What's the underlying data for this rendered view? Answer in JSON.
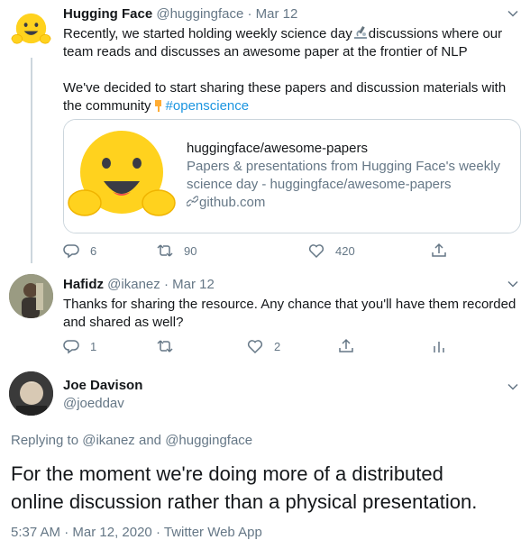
{
  "tweet1": {
    "name": "Hugging Face",
    "handle": "@huggingface",
    "separator": "·",
    "date": "Mar 12",
    "line1": "Recently, we started holding weekly science day",
    "line1b": "discussions where our",
    "line2": "team reads and discusses an awesome paper at the frontier of NLP",
    "line3": "We've decided to start sharing these papers and discussion materials with",
    "line4": "the community",
    "hashtag": "#openscience",
    "card": {
      "title": "huggingface/awesome-papers",
      "description_line1": "Papers & presentations from Hugging Face's weekly",
      "description_line2": "science day - huggingface/awesome-papers",
      "link": "github.com"
    },
    "actions": {
      "reply_count": "6",
      "retweet_count": "90",
      "like_count": "420"
    }
  },
  "tweet2": {
    "name": "Hafidz",
    "handle": "@ikanez",
    "separator": "·",
    "date": "Mar 12",
    "line1": "Thanks for sharing the resource. Any chance that you'll have them recorded",
    "line2": "and shared as well?",
    "actions": {
      "reply_count": "1",
      "retweet_count": "",
      "like_count": "2"
    }
  },
  "tweet3": {
    "name": "Joe Davison",
    "handle": "@joeddav",
    "replying_prefix": "Replying to",
    "replying_user1": "@ikanez",
    "replying_and": "and",
    "replying_user2": "@huggingface",
    "line1": "For the moment we're doing more of a distributed",
    "line2": "online discussion rather than a physical presentation.",
    "time": "5:37 AM",
    "date": "Mar 12, 2020",
    "source": "Twitter Web App",
    "footer_sep": "·"
  },
  "colors": {
    "primary_text": "#14171a",
    "secondary_text": "#657786",
    "link": "#1b95e0",
    "border": "#ccd6dd",
    "hf_yellow": "#FFD21E"
  }
}
